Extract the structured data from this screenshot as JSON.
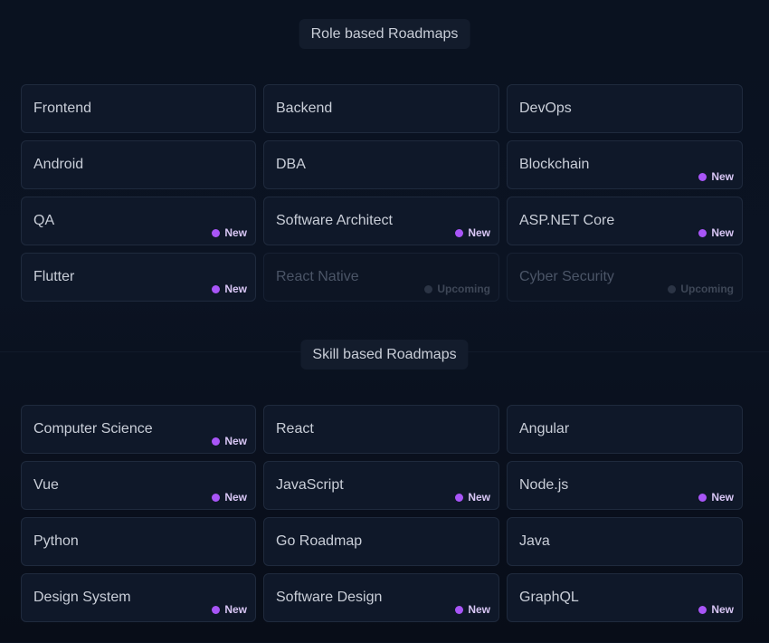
{
  "colors": {
    "background": "#0a1220",
    "card": "#0f1829",
    "card_border": "#1f2a3d",
    "new_dot": "#a855f7",
    "upcoming_dot": "#2b3445"
  },
  "role_section": {
    "title": "Role based Roadmaps",
    "cards": [
      {
        "label": "Frontend",
        "badge": ""
      },
      {
        "label": "Backend",
        "badge": ""
      },
      {
        "label": "DevOps",
        "badge": ""
      },
      {
        "label": "Android",
        "badge": ""
      },
      {
        "label": "DBA",
        "badge": ""
      },
      {
        "label": "Blockchain",
        "badge": "New"
      },
      {
        "label": "QA",
        "badge": "New"
      },
      {
        "label": "Software Architect",
        "badge": "New"
      },
      {
        "label": "ASP.NET Core",
        "badge": "New"
      },
      {
        "label": "Flutter",
        "badge": "New"
      },
      {
        "label": "React Native",
        "badge": "Upcoming"
      },
      {
        "label": "Cyber Security",
        "badge": "Upcoming"
      }
    ]
  },
  "skill_section": {
    "title": "Skill based Roadmaps",
    "cards": [
      {
        "label": "Computer Science",
        "badge": "New"
      },
      {
        "label": "React",
        "badge": ""
      },
      {
        "label": "Angular",
        "badge": ""
      },
      {
        "label": "Vue",
        "badge": "New"
      },
      {
        "label": "JavaScript",
        "badge": "New"
      },
      {
        "label": "Node.js",
        "badge": "New"
      },
      {
        "label": "Python",
        "badge": ""
      },
      {
        "label": "Go Roadmap",
        "badge": ""
      },
      {
        "label": "Java",
        "badge": ""
      },
      {
        "label": "Design System",
        "badge": "New"
      },
      {
        "label": "Software Design",
        "badge": "New"
      },
      {
        "label": "GraphQL",
        "badge": "New"
      }
    ]
  }
}
